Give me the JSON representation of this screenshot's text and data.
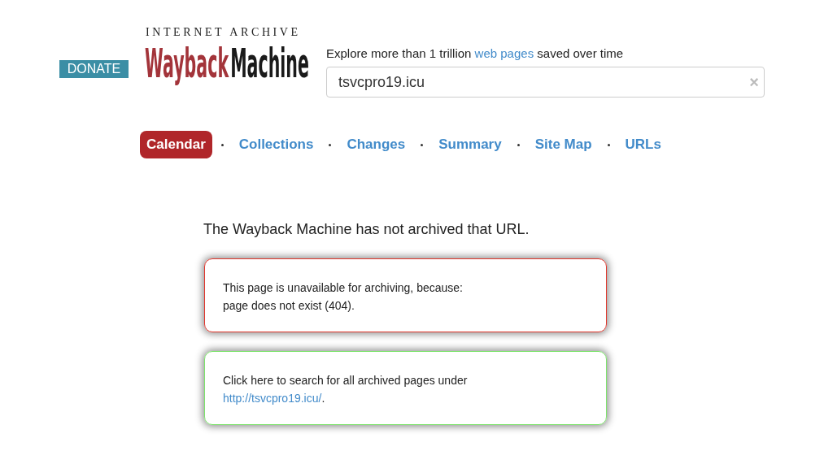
{
  "donate": {
    "label": "DONATE"
  },
  "logo": {
    "top": "INTERNET ARCHIVE",
    "parts": [
      {
        "text": "Wayback",
        "color": "#a3343a"
      },
      {
        "text": "Machine",
        "color": "#1a1a1a"
      }
    ]
  },
  "tagline": {
    "before": "Explore more than 1 trillion ",
    "link": "web pages",
    "after": " saved over time"
  },
  "search": {
    "value": "tsvcpro19.icu",
    "clear": "×"
  },
  "tabs": [
    {
      "label": "Calendar",
      "selected": true
    },
    {
      "label": "Collections",
      "selected": false
    },
    {
      "label": "Changes",
      "selected": false
    },
    {
      "label": "Summary",
      "selected": false
    },
    {
      "label": "Site Map",
      "selected": false
    },
    {
      "label": "URLs",
      "selected": false
    }
  ],
  "heading": "The Wayback Machine has not archived that URL.",
  "cards": [
    {
      "kind": "error",
      "lines": [
        "This page is unavailable for archiving, because:",
        "page does not exist (404)."
      ]
    },
    {
      "kind": "success",
      "lines": [
        "Click here to search for all archived pages under"
      ],
      "link": "http://tsvcpro19.icu/",
      "after": "."
    }
  ]
}
